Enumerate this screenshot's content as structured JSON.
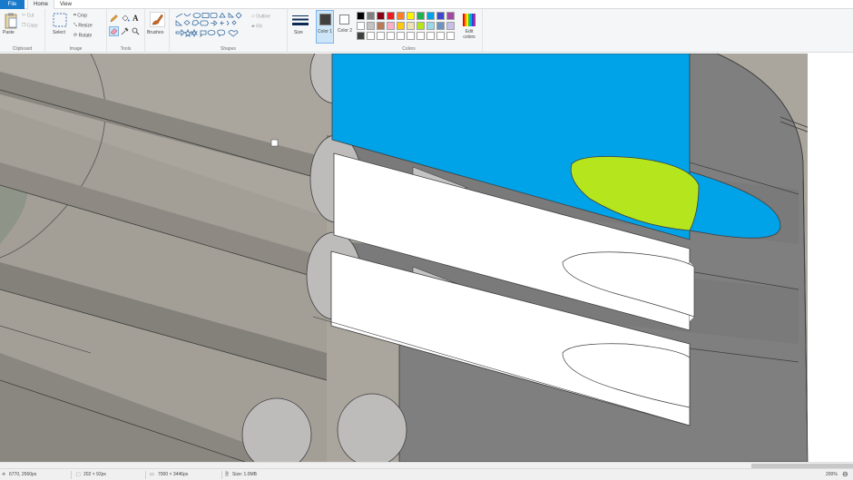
{
  "tabs": {
    "file": "File",
    "home": "Home",
    "view": "View"
  },
  "ribbon": {
    "clipboard": {
      "label": "Clipboard",
      "paste": "Paste",
      "cut": "Cut",
      "copy": "Copy"
    },
    "image": {
      "label": "Image",
      "select": "Select",
      "crop": "Crop",
      "resize": "Resize",
      "rotate": "Rotate"
    },
    "tools": {
      "label": "Tools"
    },
    "brushes": {
      "label": "Brushes"
    },
    "shapes": {
      "label": "Shapes",
      "outline": "Outline",
      "fill": "Fill"
    },
    "size": {
      "label": "Size"
    },
    "color1": {
      "label": "Color 1"
    },
    "color2": {
      "label": "Color 2"
    },
    "colors": {
      "label": "Colors",
      "edit": "Edit colors"
    }
  },
  "palette": {
    "row1": [
      "#000000",
      "#7f7f7f",
      "#880015",
      "#ed1c24",
      "#ff7f27",
      "#fff200",
      "#22b14c",
      "#00a2e8",
      "#3f48cc",
      "#a349a4"
    ],
    "row2": [
      "#ffffff",
      "#c3c3c3",
      "#b97a57",
      "#ffaec9",
      "#ffc90e",
      "#efe4b0",
      "#b5e61d",
      "#99d9ea",
      "#7092be",
      "#c8bfe7"
    ],
    "row3": [
      "#ffffff",
      "#ffffff",
      "#ffffff",
      "#ffffff",
      "#ffffff",
      "#ffffff",
      "#ffffff",
      "#ffffff",
      "#ffffff",
      "#ffffff"
    ],
    "color1_value": "#404040",
    "color2_value": "#ffffff",
    "row3_first": "#404040"
  },
  "status": {
    "cursor": "6770, 2560px",
    "selection": "202 × 92px",
    "canvas_size": "7000 × 3446px",
    "file_size": "Size: 1.0MB",
    "zoom": "200%"
  },
  "colors": {
    "accent": "#1979ca",
    "blue_fill": "#00a2e8",
    "lime_fill": "#b5e61d",
    "gray_body": "#7f7f7f",
    "tan": "#b0aca4"
  }
}
